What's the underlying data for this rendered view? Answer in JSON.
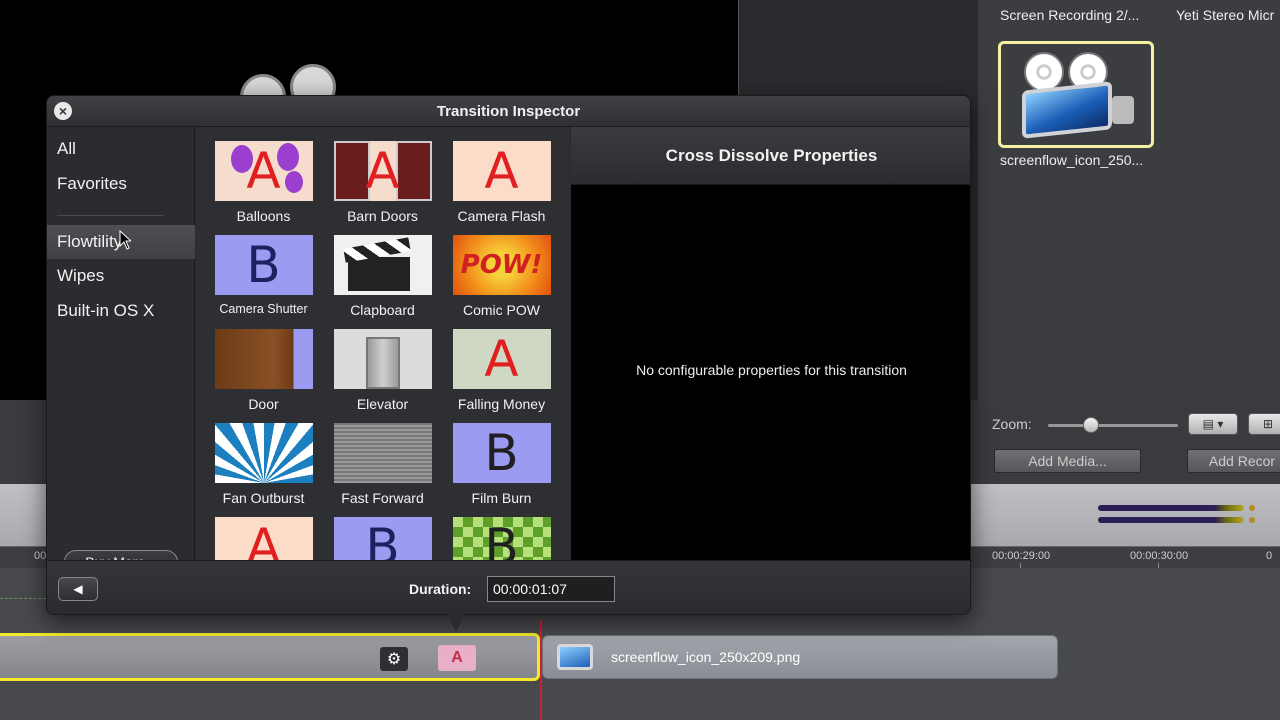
{
  "inspector": {
    "title": "Transition Inspector",
    "categories": [
      "All",
      "Favorites",
      "Flowtility",
      "Wipes",
      "Built-in OS X"
    ],
    "selected_category": "Flowtility",
    "buy_more_label": "Buy More...",
    "transitions": [
      {
        "name": "Balloons",
        "glyph": "A"
      },
      {
        "name": "Barn Doors",
        "glyph": "A"
      },
      {
        "name": "Camera Flash",
        "glyph": "A"
      },
      {
        "name": "Camera Shutter",
        "glyph": "B"
      },
      {
        "name": "Clapboard",
        "glyph": ""
      },
      {
        "name": "Comic POW",
        "glyph": "POW!"
      },
      {
        "name": "Door",
        "glyph": ""
      },
      {
        "name": "Elevator",
        "glyph": ""
      },
      {
        "name": "Falling Money",
        "glyph": "A"
      },
      {
        "name": "Fan Outburst",
        "glyph": ""
      },
      {
        "name": "Fast Forward",
        "glyph": ""
      },
      {
        "name": "Film Burn",
        "glyph": "B"
      },
      {
        "name": "",
        "glyph": "A"
      },
      {
        "name": "",
        "glyph": "B"
      },
      {
        "name": "",
        "glyph": "B"
      }
    ],
    "properties_title": "Cross Dissolve Properties",
    "properties_message": "No configurable properties for this transition",
    "duration_label": "Duration:",
    "duration_value": "00:00:01:07"
  },
  "media": {
    "captions": [
      "Screen Recording 2/...",
      "Yeti Stereo Micr",
      "screenflow_icon_250..."
    ],
    "zoom_label": "Zoom:",
    "zoom_level": 0.33,
    "add_media_label": "Add Media...",
    "add_recording_label": "Add Recor"
  },
  "timeline": {
    "ruler_labels": [
      "00",
      "00:00:29:00",
      "00:00:30:00",
      "0"
    ],
    "clip_label": "screenflow_icon_250x209.png"
  },
  "colors": {
    "selection_yellow": "#f2ea2a",
    "playhead": "#d02030",
    "transition_red": "#e02020"
  }
}
